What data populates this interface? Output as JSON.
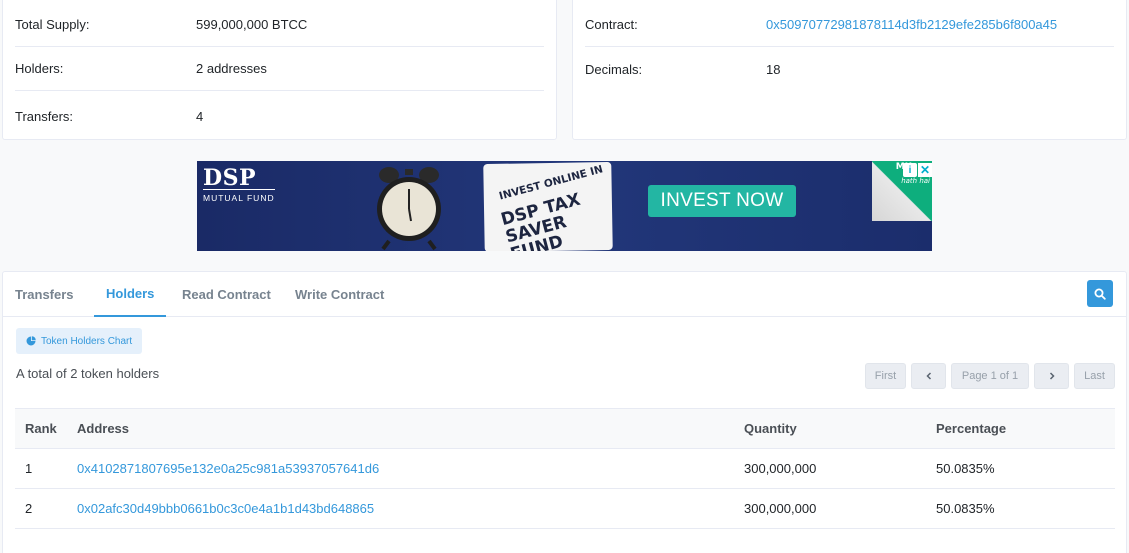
{
  "overview": {
    "left": [
      {
        "label": "Total Supply:",
        "value": "599,000,000 BTCC"
      },
      {
        "label": "Holders:",
        "value": "2 addresses"
      },
      {
        "label": "Transfers:",
        "value": "4"
      }
    ],
    "right": {
      "contract_label": "Contract:",
      "contract_value": "0x50970772981878114d3fb2129efe285b6f800a45",
      "decimals_label": "Decimals:",
      "decimals_value": "18"
    }
  },
  "ad": {
    "brand": "DSP",
    "brand_sub": "MUTUAL FUND",
    "card_small": "INVEST ONLINE IN",
    "card_big_1": "DSP TAX",
    "card_big_2": "SAVER FUND",
    "cta": "INVEST NOW",
    "corner_text": "hath hai",
    "ml": "MU",
    "info": "i",
    "close": "✕"
  },
  "tabs": [
    {
      "label": "Transfers",
      "active": false
    },
    {
      "label": "Holders",
      "active": true
    },
    {
      "label": "Read Contract",
      "active": false
    },
    {
      "label": "Write Contract",
      "active": false
    }
  ],
  "chart_button": "Token Holders Chart",
  "total_text": "A total of 2 token holders",
  "pagination": {
    "first": "First",
    "info": "Page 1 of 1",
    "last": "Last"
  },
  "table": {
    "headers": [
      "Rank",
      "Address",
      "Quantity",
      "Percentage"
    ],
    "rows": [
      {
        "rank": "1",
        "address": "0x4102871807695e132e0a25c981a53937057641d6",
        "quantity": "300,000,000",
        "percentage": "50.0835%"
      },
      {
        "rank": "2",
        "address": "0x02afc30d49bbb0661b0c3c0e4a1b1d43bd648865",
        "quantity": "300,000,000",
        "percentage": "50.0835%"
      }
    ]
  },
  "colors": {
    "link": "#3498db",
    "ad_background": "#1d2f6b",
    "cta": "#23b6a3"
  }
}
